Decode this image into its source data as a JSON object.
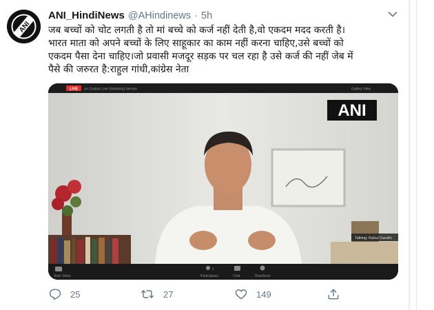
{
  "tweet": {
    "display_name": "ANI_HindiNews",
    "handle": "@AHindinews",
    "separator": "·",
    "time": "5h",
    "text_lines": [
      "जब बच्चों को चोट लगती है तो मां बच्चे को कर्ज नहीं देती है,वो एकदम मदद करती है।",
      "भारत माता को अपने बच्चों के लिए साहूकार का काम नहीं करना चाहिए,उसे बच्चों को",
      "एकदम पैसा देना चाहिए।जो प्रवासी मजदूर सड़क पर चल रहा है उसे कर्ज की नहीं जेब में",
      "पैसे की जरुरत है:राहुल गांधी,कांग्रेस नेता"
    ],
    "avatar_text": "ANI"
  },
  "media": {
    "live_badge": "LIVE",
    "stream_label": "on Custom Live Streaming Service",
    "watermark": "ANI",
    "top_right_label": "Gallery View",
    "caption": "Talking: Rahul Gandhi",
    "controls": {
      "participants_count": "1",
      "participants_label": "Participants",
      "chat_label": "Chat",
      "reactions_label": "Reactions",
      "start_video_label": "Start Video"
    }
  },
  "actions": {
    "reply_count": "25",
    "retweet_count": "27",
    "like_count": "149"
  },
  "colors": {
    "text_secondary": "#657786",
    "live_red": "#e02f2f",
    "background": "#e6ecf0"
  }
}
